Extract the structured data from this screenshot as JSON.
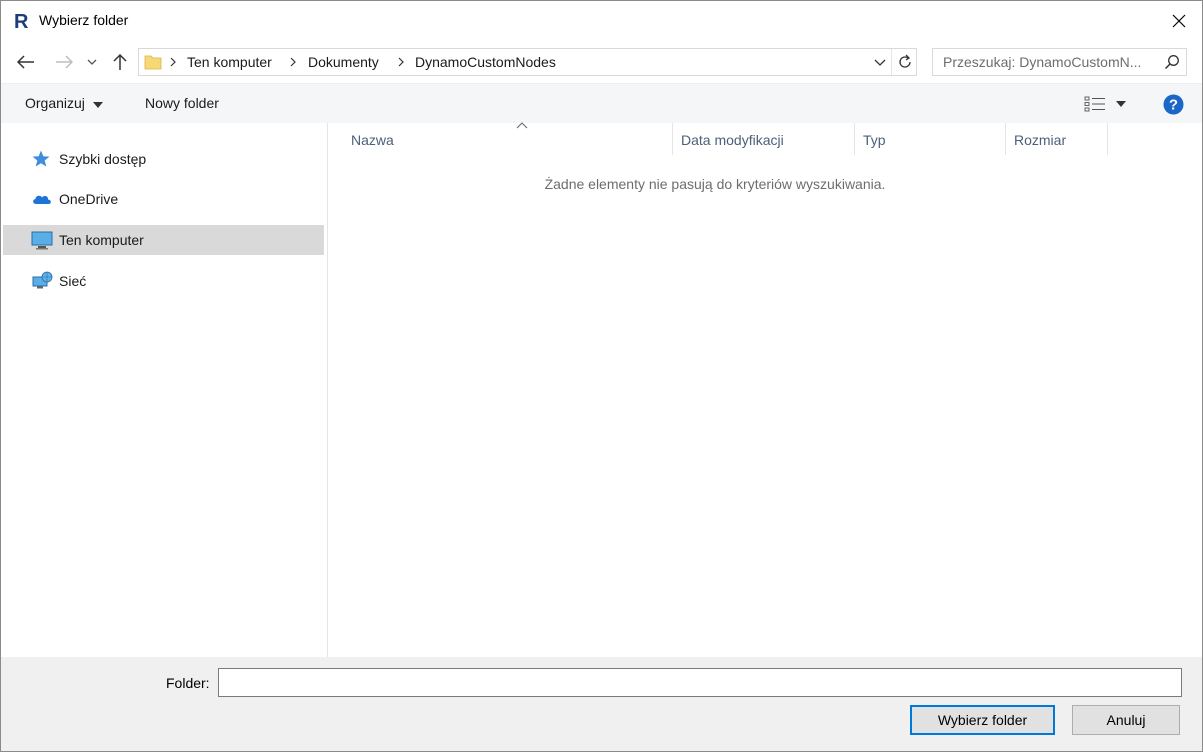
{
  "window": {
    "title": "Wybierz folder",
    "app_icon": "revit-r-icon",
    "accent_color": "#0078d7"
  },
  "navigation": {
    "back_icon": "arrow-left-icon",
    "forward_icon": "arrow-right-icon",
    "recent_icon": "chevron-down-icon",
    "up_icon": "arrow-up-icon"
  },
  "address": {
    "crumbs": [
      "Ten komputer",
      "Dokumenty",
      "DynamoCustomNodes"
    ]
  },
  "search": {
    "placeholder": "Przeszukaj: DynamoCustomN..."
  },
  "toolbar": {
    "organize_label": "Organizuj",
    "new_folder_label": "Nowy folder"
  },
  "sidebar": {
    "items": [
      {
        "label": "Szybki dostęp",
        "icon": "star-icon",
        "selected": false
      },
      {
        "label": "OneDrive",
        "icon": "cloud-icon",
        "selected": false
      },
      {
        "label": "Ten komputer",
        "icon": "computer-icon",
        "selected": true
      },
      {
        "label": "Sieć",
        "icon": "network-icon",
        "selected": false
      }
    ]
  },
  "list": {
    "columns": [
      "Nazwa",
      "Data modyfikacji",
      "Typ",
      "Rozmiar"
    ],
    "empty_message": "Żadne elementy nie pasują do kryteriów wyszukiwania."
  },
  "footer": {
    "folder_label": "Folder:",
    "folder_value": "",
    "select_button": "Wybierz folder",
    "cancel_button": "Anuluj"
  }
}
